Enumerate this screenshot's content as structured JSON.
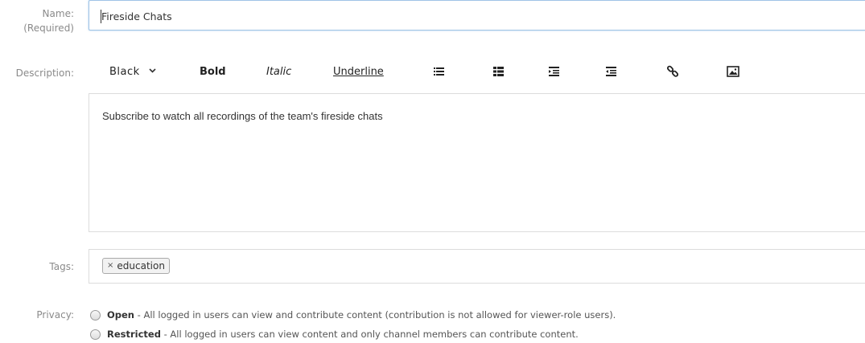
{
  "form": {
    "name_label": "Name:",
    "name_required": "(Required)",
    "name_value": "Fireside Chats",
    "description_label": "Description:",
    "tags_label": "Tags:",
    "privacy_label": "Privacy:"
  },
  "toolbar": {
    "color_select": "Black",
    "bold": "Bold",
    "italic": "Italic",
    "underline": "Underline",
    "icons": [
      "ordered-list-icon",
      "bulleted-list-icon",
      "indent-icon",
      "outdent-icon",
      "link-icon",
      "image-icon"
    ]
  },
  "editor": {
    "content": "Subscribe to watch all recordings of the team's fireside chats"
  },
  "tags": [
    {
      "remove": "×",
      "label": "education"
    }
  ],
  "privacy": {
    "options": [
      {
        "title": "Open",
        "description": " - All logged in users can view and contribute content (contribution is not allowed for viewer-role users)."
      },
      {
        "title": "Restricted",
        "description": " - All logged in users can view content and only channel members can contribute content."
      }
    ]
  }
}
